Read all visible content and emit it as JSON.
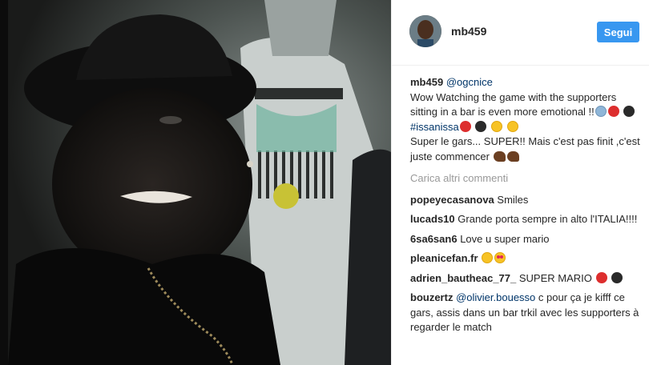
{
  "header": {
    "username": "mb459",
    "follow_label": "Segui"
  },
  "caption": {
    "username": "mb459",
    "mention": "@ogcnice",
    "text1": "Wow Watching the game with the supporters sitting in a bar is even more emotional !!",
    "hashtag": "#issanissa",
    "text2": "Super le gars... SUPER!! Mais c'est pas finit ,c'est juste commencer"
  },
  "load_more_label": "Carica altri commenti",
  "comments": [
    {
      "username": "popeyecasanova",
      "text": "Smiles"
    },
    {
      "username": "lucads10",
      "text": "Grande porta sempre in alto l'ITALIA!!!!"
    },
    {
      "username": "6sa6san6",
      "text": "Love u super mario"
    },
    {
      "username": "pleanicefan.fr",
      "text": ""
    },
    {
      "username": "adrien_bautheac_77_",
      "text": "SUPER MARIO"
    },
    {
      "username": "bouzertz",
      "mention": "@olivier.bouesso",
      "text": "c pour ça je kifff ce gars, assis dans un bar trkil avec les supporters à regarder le match"
    }
  ],
  "colors": {
    "accent": "#3897f0",
    "mention": "#003569",
    "muted": "#999999",
    "text": "#262626"
  },
  "icons": [
    "video-frame",
    "avatar",
    "emoji-scream",
    "emoji-red-circle",
    "emoji-black-circle",
    "emoji-smile",
    "emoji-flexed-arm",
    "emoji-grin",
    "emoji-heart-eyes"
  ]
}
